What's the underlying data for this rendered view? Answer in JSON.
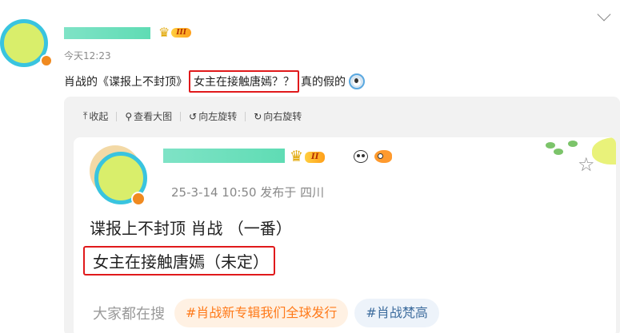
{
  "post": {
    "time": "今天12:23",
    "text_before": "肖战的《谍报上不封顶》",
    "text_highlight": "女主在接触唐嫣？？",
    "text_after": "真的假的",
    "vip_level": "III"
  },
  "toolbar": {
    "collapse": "收起",
    "view_large": "查看大图",
    "rotate_left": "向左旋转",
    "rotate_right": "向右旋转"
  },
  "repost": {
    "vip_level": "II",
    "meta": "25-3-14 10:50  发布于 四川",
    "line1": "谍报上不封顶 肖战 （一番）",
    "line2": "女主在接触唐嫣（未定）",
    "search_label": "大家都在搜",
    "tags": [
      "#肖战新专辑我们全球发行",
      "#肖战梵高"
    ]
  },
  "colors": {
    "highlight_border": "#e0191b",
    "avatar_ring": "#39c4df",
    "hot_tag_text": "#ff7a1a"
  }
}
